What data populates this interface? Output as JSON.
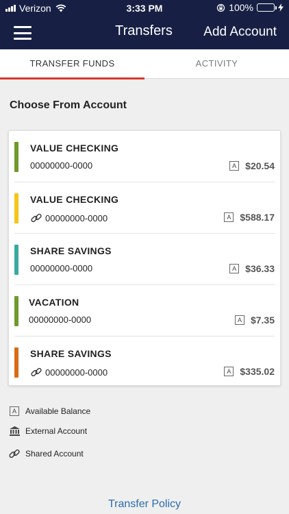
{
  "status_bar": {
    "carrier": "Verizon",
    "time": "3:33 PM",
    "battery": "100%"
  },
  "nav": {
    "title": "Transfers",
    "add_account": "Add Account"
  },
  "tabs": [
    {
      "label": "TRANSFER FUNDS",
      "active": true
    },
    {
      "label": "ACTIVITY",
      "active": false
    }
  ],
  "section_title": "Choose From Account",
  "accounts": [
    {
      "name": "VALUE CHECKING",
      "number": "00000000-0000",
      "badge": "A",
      "amount": "$20.54",
      "color": "#6f9a2c",
      "shared": false
    },
    {
      "name": "VALUE CHECKING",
      "number": "00000000-0000",
      "badge": "A",
      "amount": "$588.17",
      "color": "#f5c518",
      "shared": true
    },
    {
      "name": "SHARE SAVINGS",
      "number": "00000000-0000",
      "badge": "A",
      "amount": "$36.33",
      "color": "#39a9a0",
      "shared": false
    },
    {
      "name": "VACATION",
      "number": "00000000-0000",
      "badge": "A",
      "amount": "$7.35",
      "color": "#6f9a2c",
      "shared": false
    },
    {
      "name": "SHARE SAVINGS",
      "number": "00000000-0000",
      "badge": "A",
      "amount": "$335.02",
      "color": "#d96b16",
      "shared": true
    }
  ],
  "legend": {
    "available_badge": "A",
    "available": "Available Balance",
    "external": "External Account",
    "shared": "Shared Account"
  },
  "footer": {
    "policy": "Transfer Policy"
  },
  "icons": [
    "menu-icon",
    "wifi-icon",
    "battery-icon",
    "link-icon",
    "bank-icon"
  ]
}
